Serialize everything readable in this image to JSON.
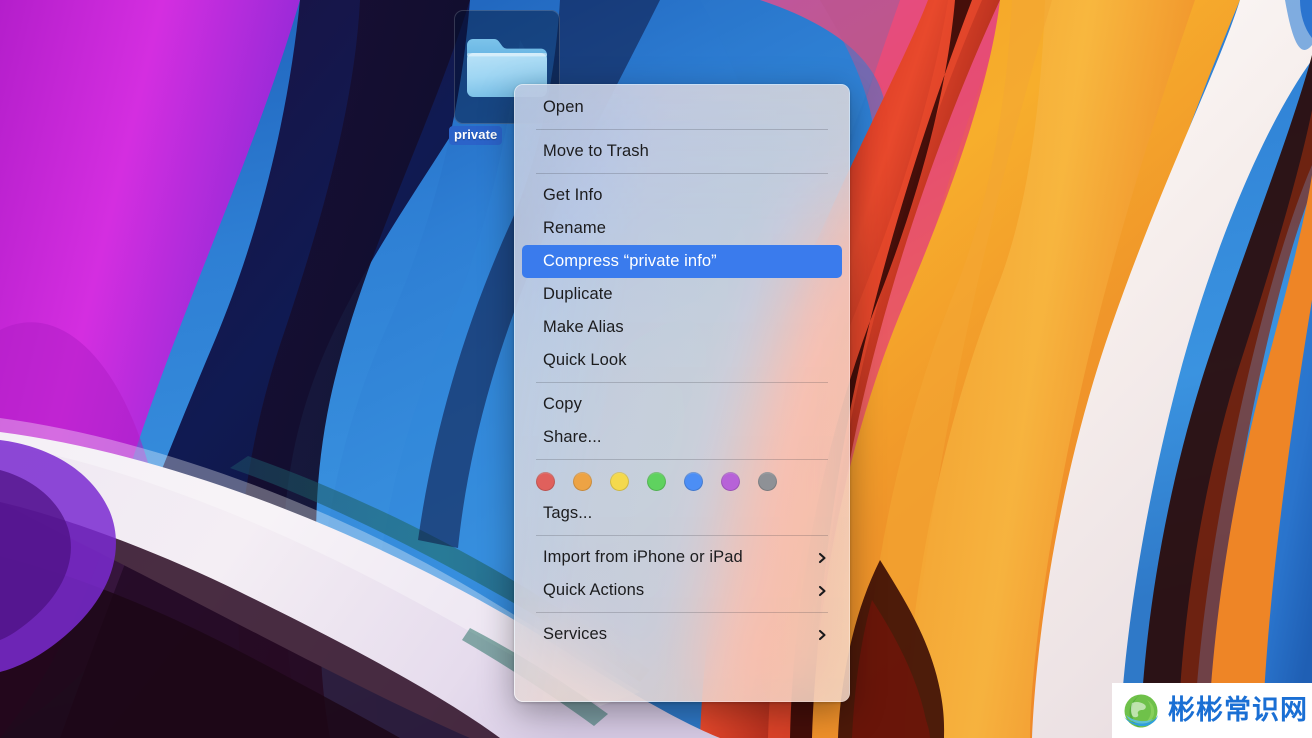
{
  "desktop": {
    "icon": {
      "name": "private info",
      "visible_label": "private",
      "kind": "folder",
      "selected": true,
      "label_highlight_color": "#2b63c9",
      "folder_color": "#8fcbf0"
    },
    "wallpaper": {
      "name": "macOS Monterey Abstract",
      "colors": [
        "#c32ad6",
        "#0e1f55",
        "#2f7ddb",
        "#e0454a",
        "#f08a2b",
        "#f6b12a",
        "#f2ece9",
        "#2b6fd1"
      ]
    }
  },
  "context_menu": {
    "target": "private info",
    "sections": [
      {
        "id": "open",
        "items": [
          {
            "label": "Open",
            "submenu": false,
            "selected": false
          }
        ]
      },
      {
        "id": "trash",
        "items": [
          {
            "label": "Move to Trash",
            "submenu": false,
            "selected": false
          }
        ]
      },
      {
        "id": "file-ops",
        "items": [
          {
            "label": "Get Info",
            "submenu": false,
            "selected": false
          },
          {
            "label": "Rename",
            "submenu": false,
            "selected": false
          },
          {
            "label": "Compress “private info”",
            "submenu": false,
            "selected": true
          },
          {
            "label": "Duplicate",
            "submenu": false,
            "selected": false
          },
          {
            "label": "Make Alias",
            "submenu": false,
            "selected": false
          },
          {
            "label": "Quick Look",
            "submenu": false,
            "selected": false
          }
        ]
      },
      {
        "id": "share",
        "items": [
          {
            "label": "Copy",
            "submenu": false,
            "selected": false
          },
          {
            "label": "Share...",
            "submenu": false,
            "selected": false
          }
        ]
      },
      {
        "id": "tags",
        "tag_colors": [
          {
            "name": "red",
            "hex": "#e0605c"
          },
          {
            "name": "orange",
            "hex": "#eda344"
          },
          {
            "name": "yellow",
            "hex": "#f4d94d"
          },
          {
            "name": "green",
            "hex": "#5fd25f"
          },
          {
            "name": "blue",
            "hex": "#4c8ef5"
          },
          {
            "name": "purple",
            "hex": "#b濃"
          },
          {
            "name": "gray",
            "hex": "#8e9196"
          }
        ],
        "items": [
          {
            "label": "Tags...",
            "submenu": false,
            "selected": false
          }
        ]
      },
      {
        "id": "import",
        "items": [
          {
            "label": "Import from iPhone or iPad",
            "submenu": true,
            "selected": false
          },
          {
            "label": "Quick Actions",
            "submenu": true,
            "selected": false
          }
        ]
      },
      {
        "id": "services",
        "items": [
          {
            "label": "Services",
            "submenu": true,
            "selected": false
          }
        ]
      }
    ],
    "selection_color": "#3a7bed"
  },
  "tag_swatches": [
    {
      "name": "red",
      "hex": "#e0605c"
    },
    {
      "name": "orange",
      "hex": "#eda344"
    },
    {
      "name": "yellow",
      "hex": "#f4d94d"
    },
    {
      "name": "green",
      "hex": "#5fd25f"
    },
    {
      "name": "blue",
      "hex": "#4c8ef5"
    },
    {
      "name": "purple",
      "hex": "#b762d8"
    },
    {
      "name": "gray",
      "hex": "#8e9196"
    }
  ],
  "watermark": {
    "text": "彬彬常识网",
    "text_color": "#1a6fd4",
    "background": "#ffffff",
    "icon": "globe-icon"
  }
}
